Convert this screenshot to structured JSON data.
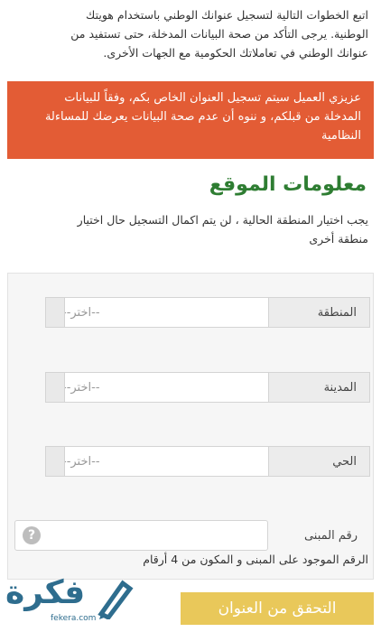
{
  "intro": {
    "line1": "اتبع الخطوات التالية لتسجيل عنوانك الوطني باستخدام هويتك",
    "line2": "الوطنية. يرجى التأكد من صحة البيانات المدخلة، حتى تستفيد من",
    "line3": "عنوانك الوطني في تعاملاتك الحكومية مع الجهات الأخرى."
  },
  "alert": {
    "line1": "عزيزي العميل سيتم تسجيل العنوان الخاص بكم، وفقاً للبيانات",
    "line2": "المدخلة من قبلكم، و ننوه أن عدم صحة البيانات يعرضك للمساءلة",
    "line3": "النظامية",
    "background_color": "#e35c35"
  },
  "section": {
    "title": "معلومات الموقع",
    "title_color": "#2e7d32",
    "note_line1": "يجب اختيار المنطقة الحالية ، لن يتم اكمال التسجيل حال اختيار",
    "note_line2": "منطقة أخرى"
  },
  "form": {
    "region": {
      "label": "المنطقة",
      "placeholder": "--اختر--"
    },
    "city": {
      "label": "المدينة",
      "placeholder": "--اختر--"
    },
    "district": {
      "label": "الحي",
      "placeholder": "--اختر--"
    },
    "building": {
      "label": "رقم المبنى",
      "value": "",
      "help_icon": "question-icon",
      "help_glyph": "?"
    },
    "building_hint": "الرقم الموجود على المبنى و المكون من 4 أرقام"
  },
  "submit": {
    "label": "التحقق من العنوان",
    "color": "#e9c85a"
  },
  "logo": {
    "text": "فكرة",
    "domain": "fekera.com",
    "icon": "pen-icon",
    "color": "#2e6d8e"
  }
}
